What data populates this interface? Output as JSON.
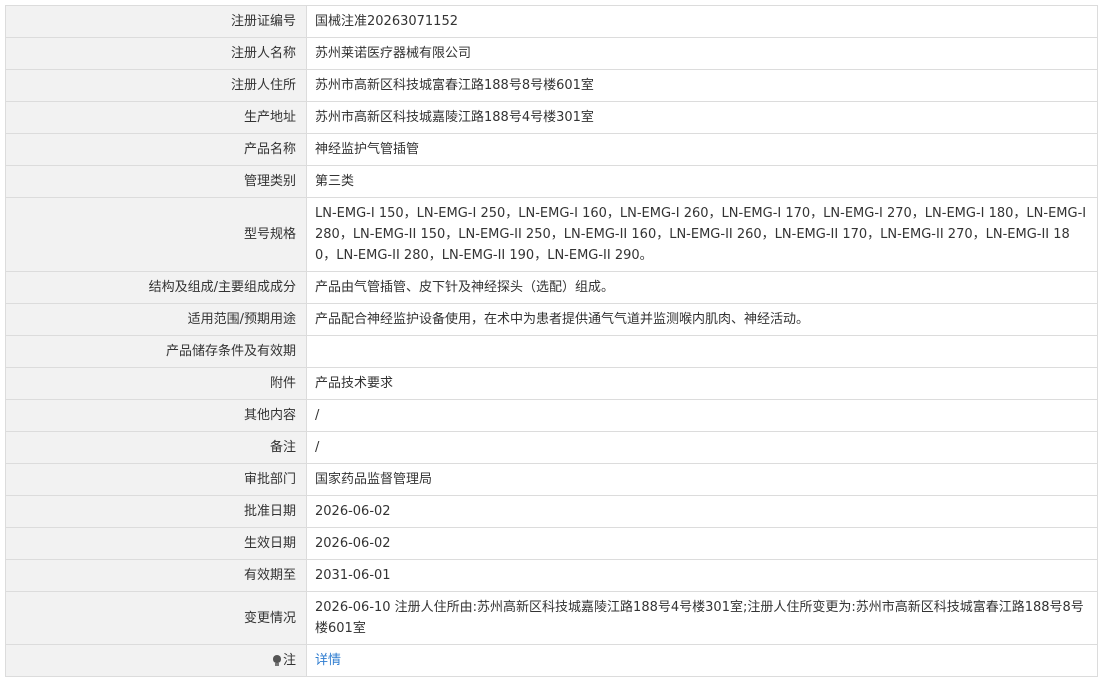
{
  "record": {
    "rows": [
      {
        "label": "注册证编号",
        "value": "国械注准20263071152"
      },
      {
        "label": "注册人名称",
        "value": "苏州莱诺医疗器械有限公司"
      },
      {
        "label": "注册人住所",
        "value": "苏州市高新区科技城富春江路188号8号楼601室"
      },
      {
        "label": "生产地址",
        "value": "苏州市高新区科技城嘉陵江路188号4号楼301室"
      },
      {
        "label": "产品名称",
        "value": "神经监护气管插管"
      },
      {
        "label": "管理类别",
        "value": "第三类"
      },
      {
        "label": "型号规格",
        "value": "LN-EMG-I 150，LN-EMG-I 250，LN-EMG-I 160，LN-EMG-I 260，LN-EMG-I 170，LN-EMG-I 270，LN-EMG-I 180，LN-EMG-I 280，LN-EMG-II 150，LN-EMG-II 250，LN-EMG-II 160，LN-EMG-II 260，LN-EMG-II 170，LN-EMG-II 270，LN-EMG-II 180，LN-EMG-II 280，LN-EMG-II 190，LN-EMG-II 290。"
      },
      {
        "label": "结构及组成/主要组成成分",
        "value": "产品由气管插管、皮下针及神经探头（选配）组成。"
      },
      {
        "label": "适用范围/预期用途",
        "value": "产品配合神经监护设备使用，在术中为患者提供通气气道并监测喉内肌肉、神经活动。"
      },
      {
        "label": "产品储存条件及有效期",
        "value": ""
      },
      {
        "label": "附件",
        "value": "产品技术要求"
      },
      {
        "label": "其他内容",
        "value": "/"
      },
      {
        "label": "备注",
        "value": "/"
      },
      {
        "label": "审批部门",
        "value": "国家药品监督管理局"
      },
      {
        "label": "批准日期",
        "value": "2026-06-02"
      },
      {
        "label": "生效日期",
        "value": "2026-06-02"
      },
      {
        "label": "有效期至",
        "value": "2031-06-01"
      },
      {
        "label": "变更情况",
        "value": "2026-06-10 注册人住所由:苏州高新区科技城嘉陵江路188号4号楼301室;注册人住所变更为:苏州市高新区科技城富春江路188号8号楼601室"
      }
    ],
    "note_row": {
      "label": "注",
      "link": "详情",
      "icon": "bulb-icon"
    }
  }
}
